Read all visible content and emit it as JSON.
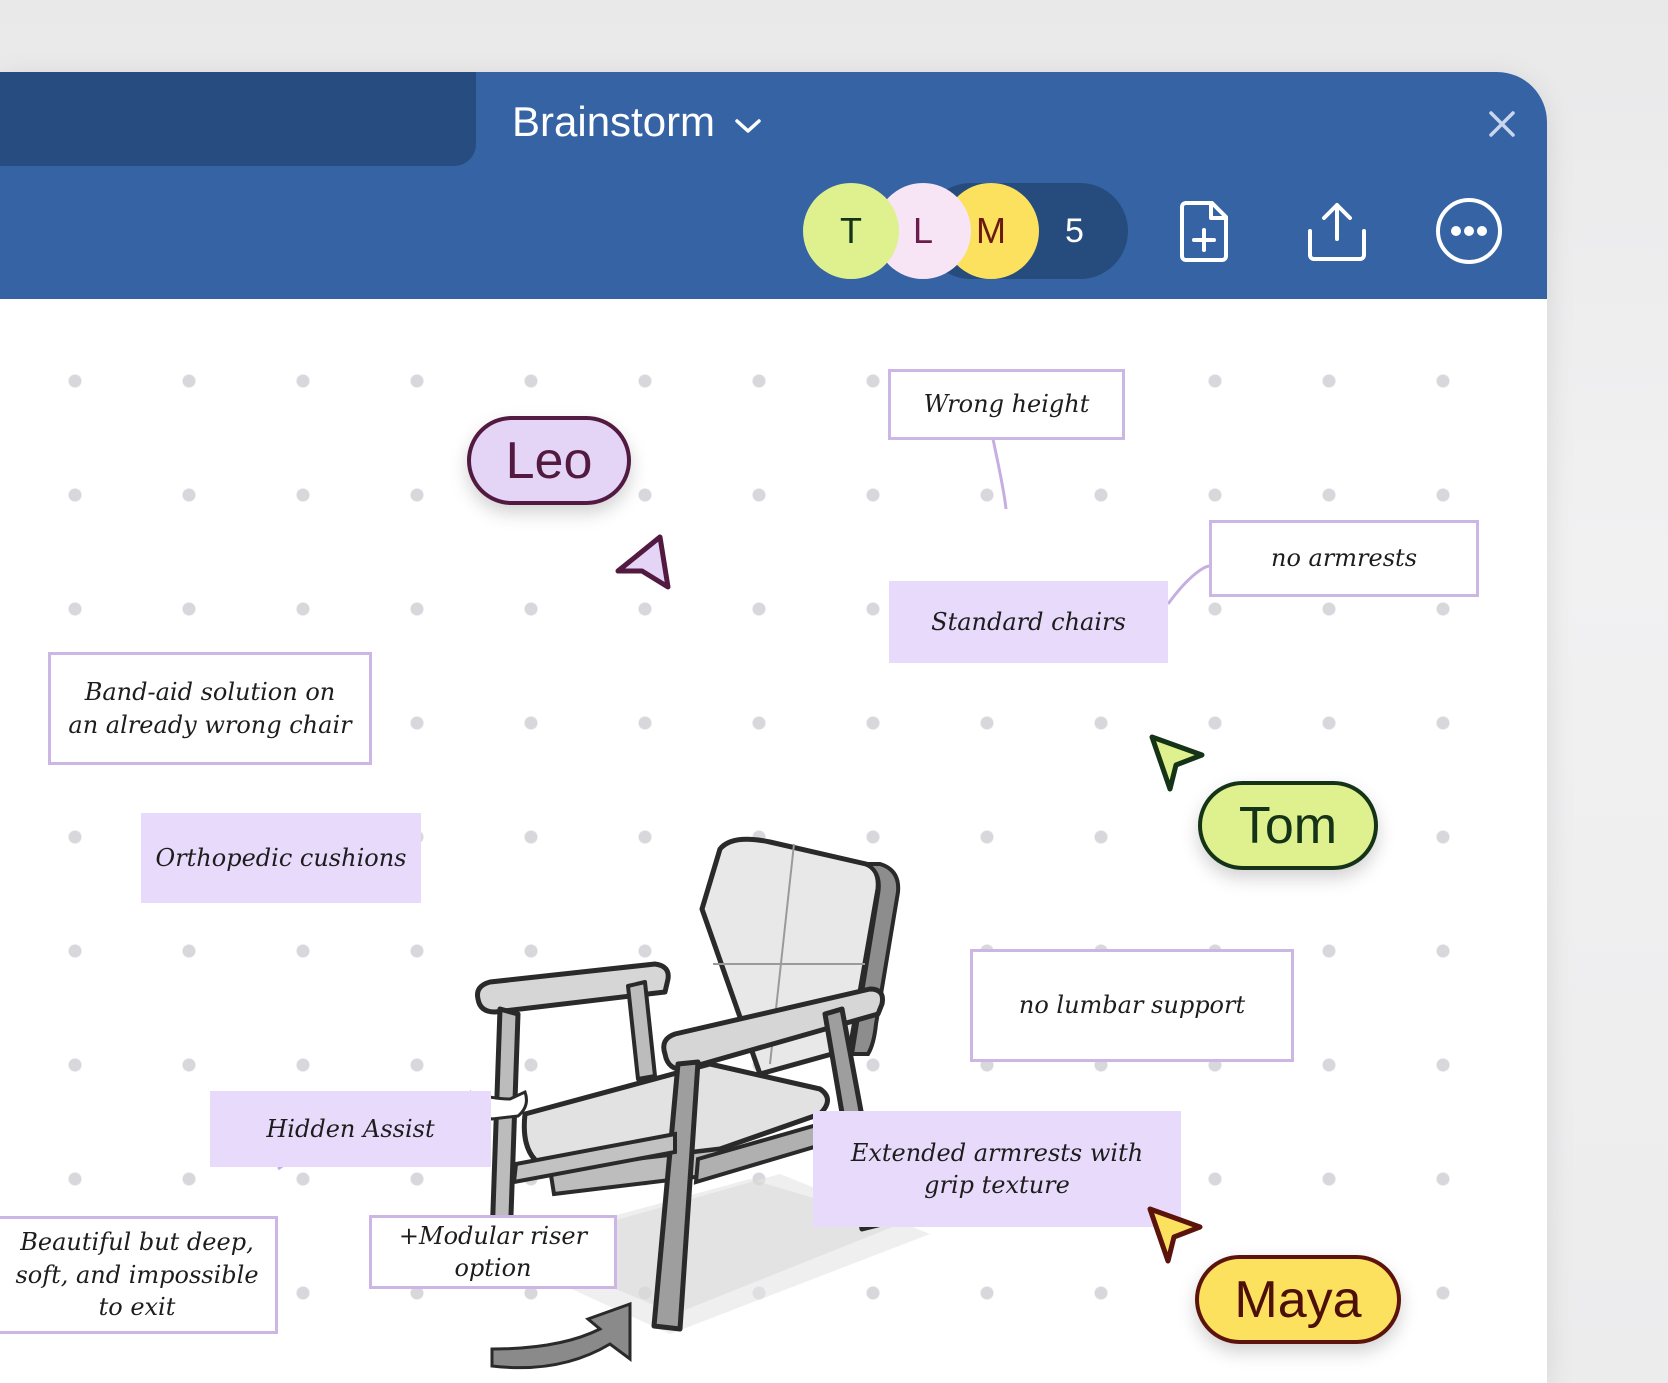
{
  "tab": {
    "title": "Brainstorm"
  },
  "collaborators": {
    "avatars": [
      {
        "initial": "T",
        "bg": "#dff08f",
        "fg": "#153317"
      },
      {
        "initial": "L",
        "bg": "#f7e4f4",
        "fg": "#6a1c4c"
      },
      {
        "initial": "M",
        "bg": "#fbe15e",
        "fg": "#6a1a10"
      }
    ],
    "count": "5"
  },
  "toolbar": {
    "add_page_icon": "file-plus-icon",
    "share_icon": "upload-icon",
    "more_icon": "more-horizontal-icon"
  },
  "colors": {
    "header": "#3563a4",
    "inactive_tab": "#274d80",
    "note_fill": "#e7dafa",
    "note_outline": "#cbb6e6",
    "connector": "#c6aee3"
  },
  "notes": {
    "wrong_height": "Wrong height",
    "no_armrests": "no armrests",
    "standard_chairs": "Standard chairs",
    "band_aid": "Band-aid solution on\nan already wrong chair",
    "orthopedic": "Orthopedic cushions",
    "no_lumbar": "no lumbar support",
    "extended_armrests": "Extended armrests with\ngrip texture",
    "hidden_assist": "Hidden Assist",
    "modular_riser": "+Modular riser option",
    "beautiful": "Beautiful but deep,\nsoft, and impossible\nto exit"
  },
  "cursors": {
    "leo": {
      "name": "Leo",
      "bg": "#e4d4f6",
      "fg": "#521a40",
      "border": "#521a40"
    },
    "tom": {
      "name": "Tom",
      "bg": "#dff08f",
      "fg": "#153317",
      "border": "#153317"
    },
    "maya": {
      "name": "Maya",
      "bg": "#fbe15e",
      "fg": "#4d0f0a",
      "border": "#5c130c"
    }
  }
}
